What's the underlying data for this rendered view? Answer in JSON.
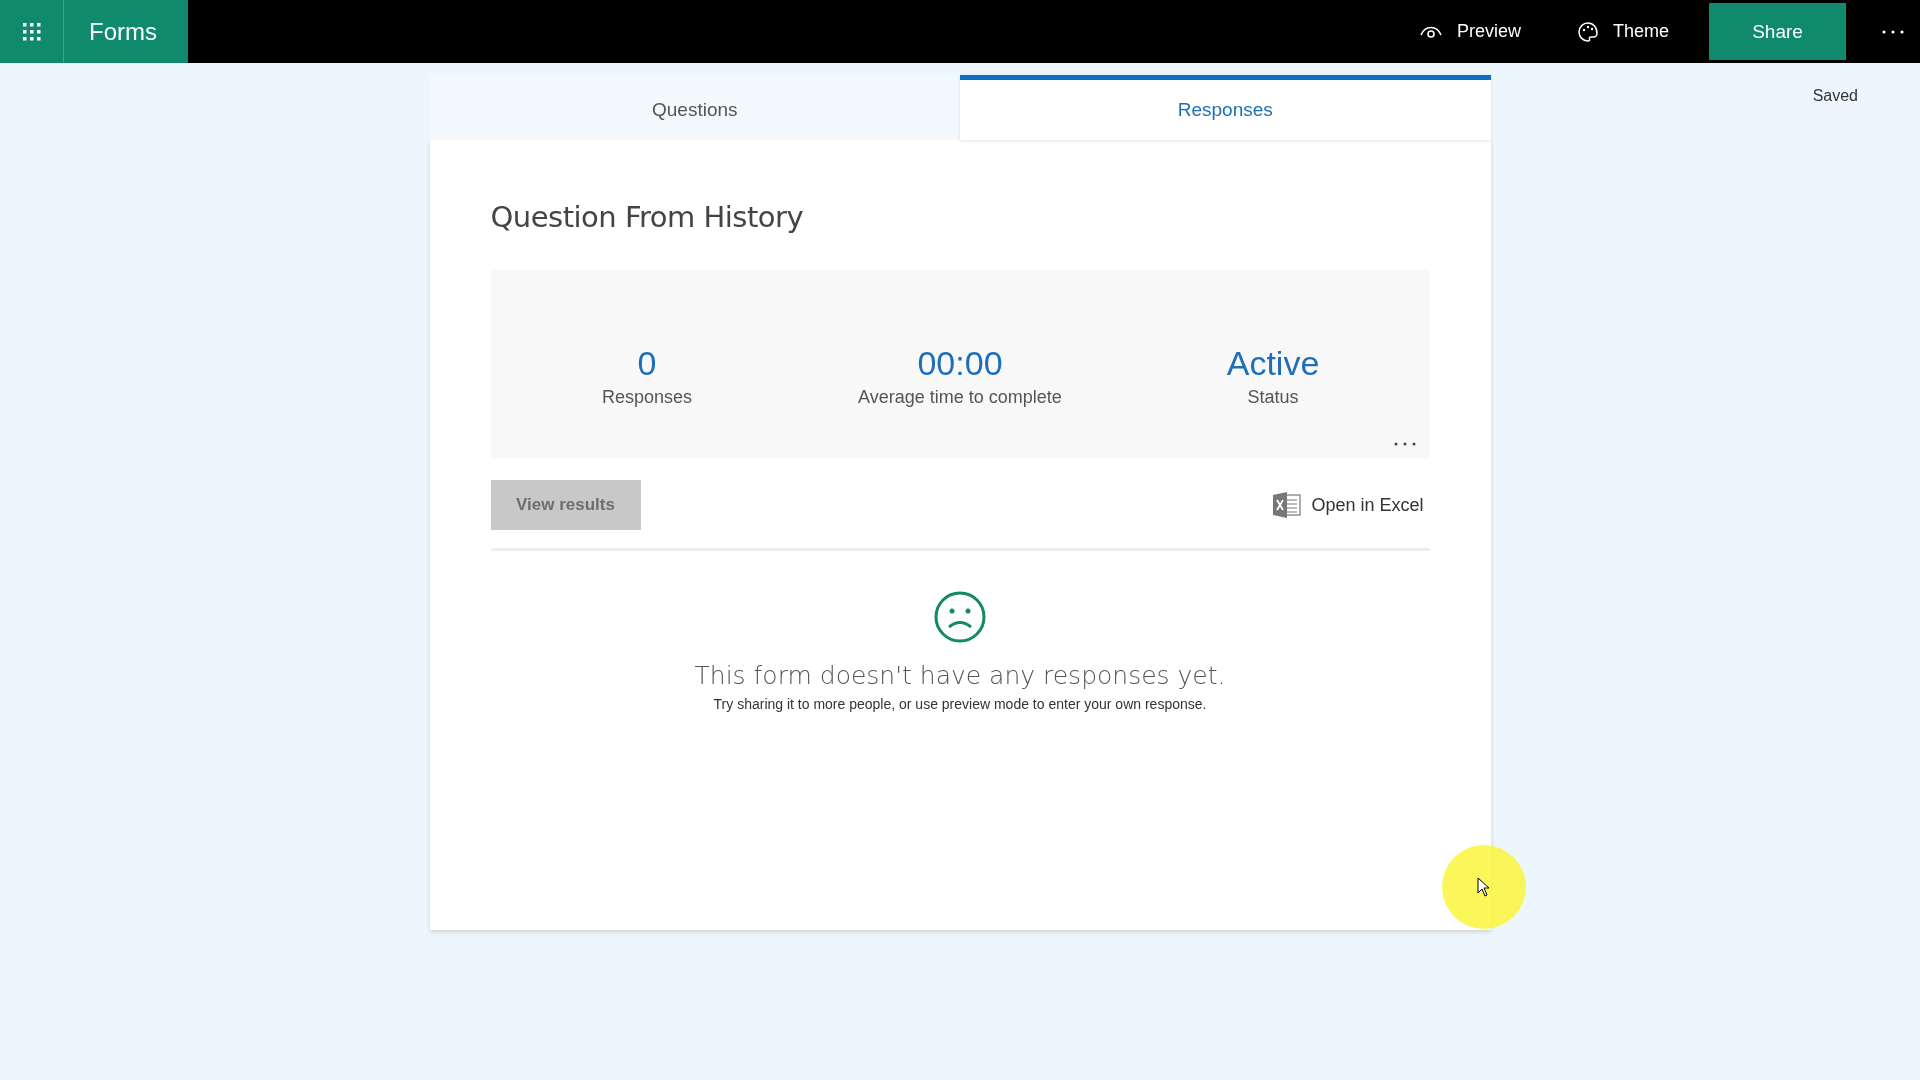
{
  "top_bar": {
    "app_name": "Forms",
    "actions": [
      {
        "kind": "preview",
        "label": "Preview"
      },
      {
        "kind": "theme",
        "label": "Theme"
      }
    ],
    "share_button": "Share"
  },
  "save_status": "Saved",
  "tabs": [
    {
      "label": "Questions",
      "selected": false
    },
    {
      "label": "Responses",
      "selected": true
    }
  ],
  "form": {
    "title": "Question From History",
    "stats": [
      {
        "value": "0",
        "label": "Responses"
      },
      {
        "value": "00:00",
        "label": "Average time to complete"
      },
      {
        "value": "Active",
        "label": "Status"
      }
    ],
    "view_results": {
      "label": "View results",
      "disabled": true
    },
    "open_in_excel": "Open in Excel",
    "empty_state": {
      "heading": "This form doesn't have any responses yet.",
      "hint": "Try sharing it to more people, or use preview mode to enter your own response."
    }
  }
}
